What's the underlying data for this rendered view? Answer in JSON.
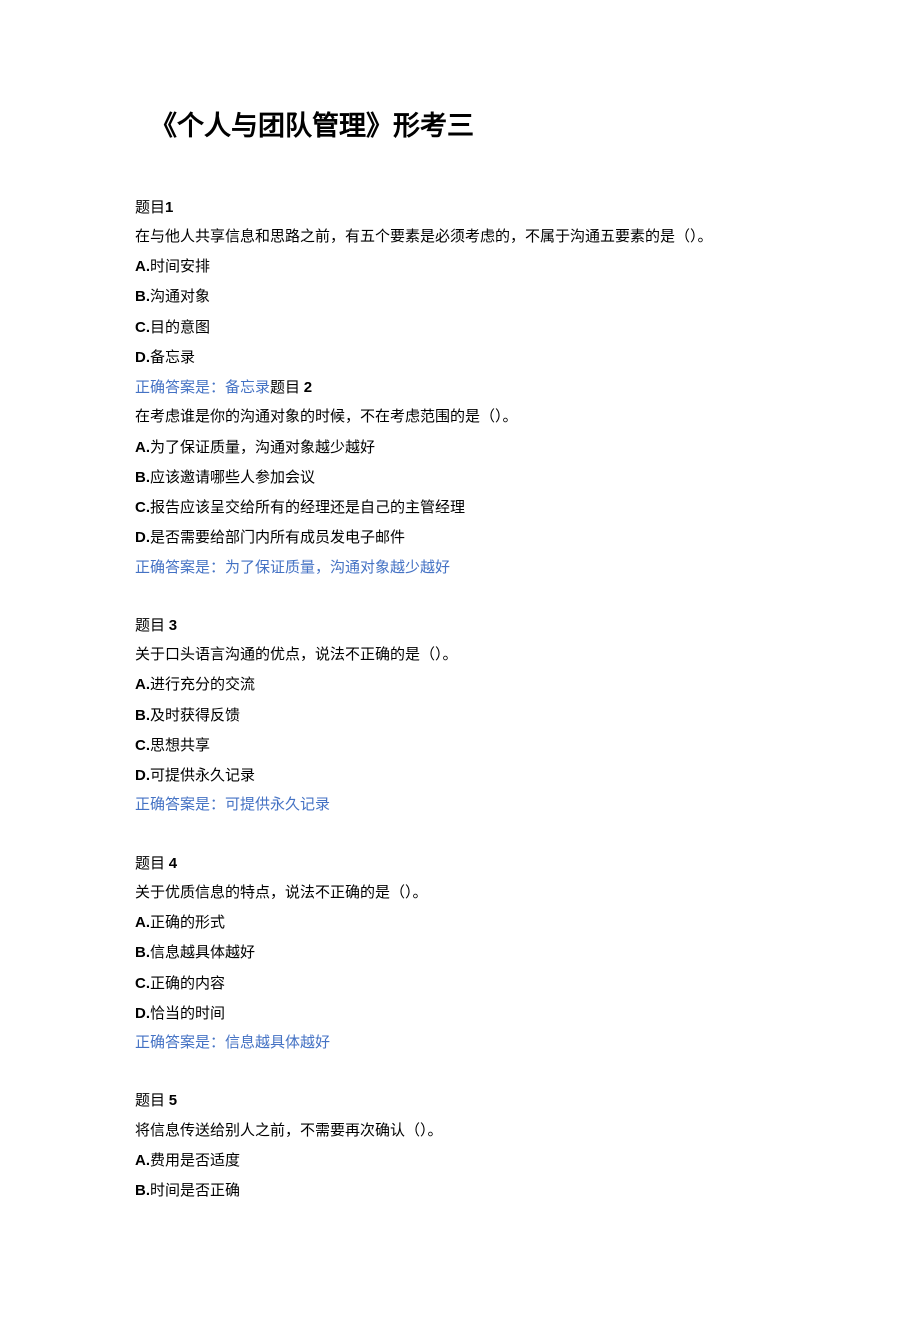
{
  "title": "《个人与团队管理》形考三",
  "questions": [
    {
      "label_prefix": "题目",
      "label_num": "1",
      "text": "在与他人共享信息和思路之前，有五个要素是必须考虑的，不属于沟通五要素的是（）。",
      "options": [
        {
          "letter": "A.",
          "text": "时间安排"
        },
        {
          "letter": "B.",
          "text": "沟通对象"
        },
        {
          "letter": "C.",
          "text": "目的意图"
        },
        {
          "letter": "D.",
          "text": "备忘录"
        }
      ],
      "answer_prefix": "正确答案是：",
      "answer_value": "备忘录",
      "inline_next": {
        "prefix": "题目",
        "num": "2"
      }
    },
    {
      "label_prefix": "",
      "label_num": "",
      "text": "在考虑谁是你的沟通对象的时候，不在考虑范围的是（）。",
      "options": [
        {
          "letter": "A.",
          "text": "为了保证质量，沟通对象越少越好"
        },
        {
          "letter": "B.",
          "text": "应该邀请哪些人参加会议"
        },
        {
          "letter": "C.",
          "text": "报告应该呈交给所有的经理还是自己的主管经理"
        },
        {
          "letter": "D.",
          "text": "是否需要给部门内所有成员发电子邮件"
        }
      ],
      "answer_prefix": "正确答案是：",
      "answer_value": "为了保证质量，沟通对象越少越好"
    },
    {
      "label_prefix": "题目",
      "label_num": "3",
      "text": "关于口头语言沟通的优点，说法不正确的是（）。",
      "options": [
        {
          "letter": "A.",
          "text": "进行充分的交流"
        },
        {
          "letter": "B.",
          "text": "及时获得反馈"
        },
        {
          "letter": "C.",
          "text": "思想共享"
        },
        {
          "letter": "D.",
          "text": "可提供永久记录"
        }
      ],
      "answer_prefix": "正确答案是：",
      "answer_value": "可提供永久记录"
    },
    {
      "label_prefix": "题目",
      "label_num": "4",
      "text": "关于优质信息的特点，说法不正确的是（）。",
      "options": [
        {
          "letter": "A.",
          "text": "正确的形式"
        },
        {
          "letter": "B.",
          "text": "信息越具体越好"
        },
        {
          "letter": "C.",
          "text": "正确的内容"
        },
        {
          "letter": "D.",
          "text": "恰当的时间"
        }
      ],
      "answer_prefix": "正确答案是：",
      "answer_value": "信息越具体越好"
    },
    {
      "label_prefix": "题目",
      "label_num": "5",
      "text": "将信息传送给别人之前，不需要再次确认（）。",
      "options": [
        {
          "letter": "A.",
          "text": "费用是否适度"
        },
        {
          "letter": "B.",
          "text": "时间是否正确"
        }
      ]
    }
  ]
}
